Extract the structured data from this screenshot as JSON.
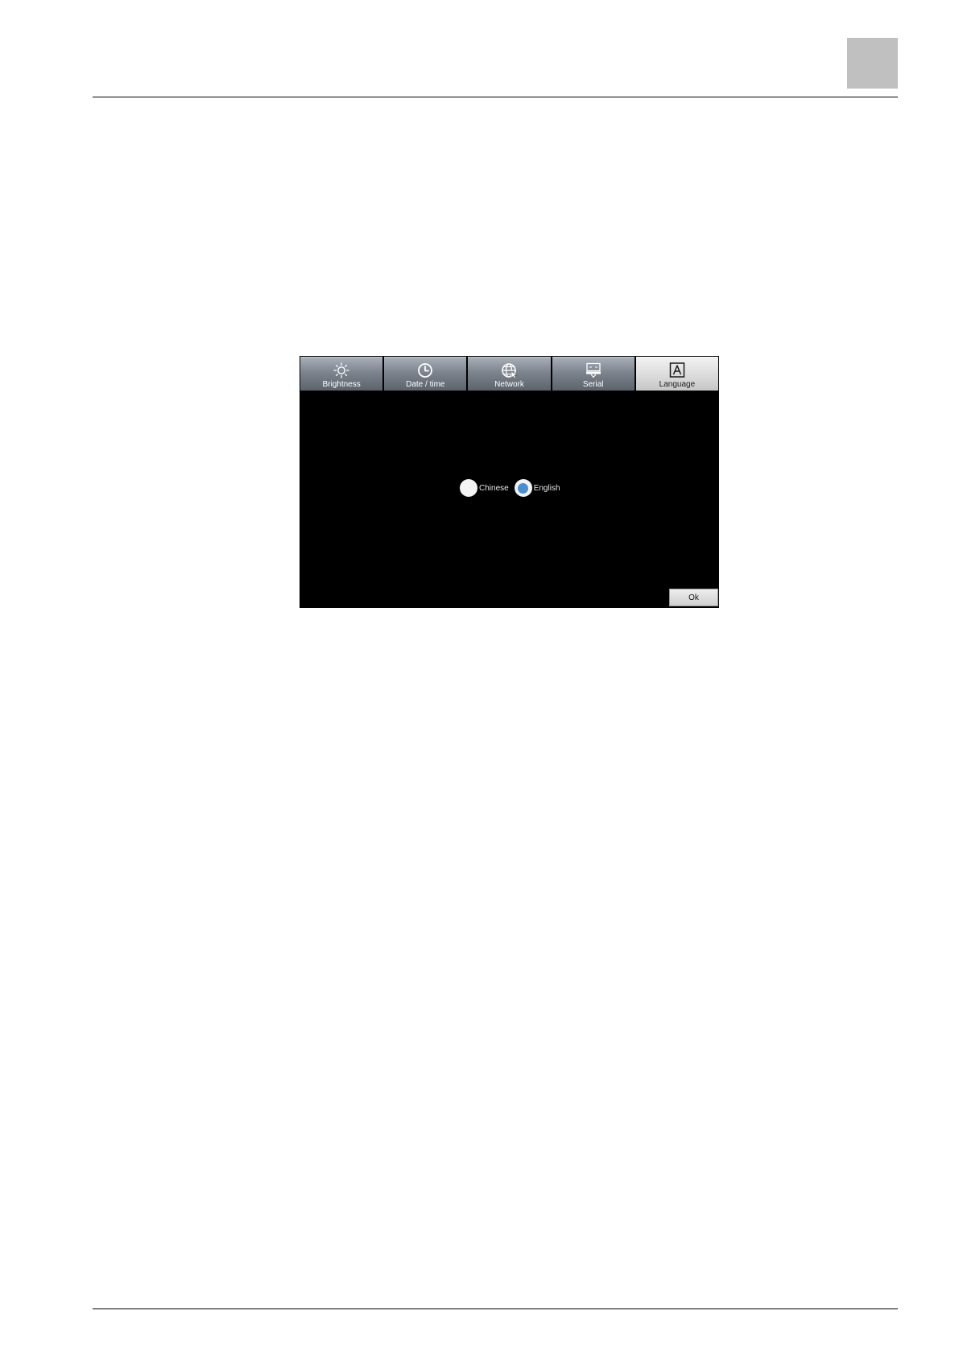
{
  "tabs": [
    {
      "label": "Brightness",
      "icon": "sun-icon",
      "active": false
    },
    {
      "label": "Date / time",
      "icon": "clock-icon",
      "active": false
    },
    {
      "label": "Network",
      "icon": "globe-icon",
      "active": false
    },
    {
      "label": "Serial",
      "icon": "serial-port-icon",
      "active": false
    },
    {
      "label": "Language",
      "icon": "letter-a-icon",
      "active": true
    }
  ],
  "language_options": [
    {
      "label": "Chinese",
      "selected": false
    },
    {
      "label": "English",
      "selected": true
    }
  ],
  "ok_label": "Ok",
  "colors": {
    "screen_background": "#000000",
    "radio_selected": "#4a8fd6",
    "corner_box": "#c0c0c0"
  }
}
